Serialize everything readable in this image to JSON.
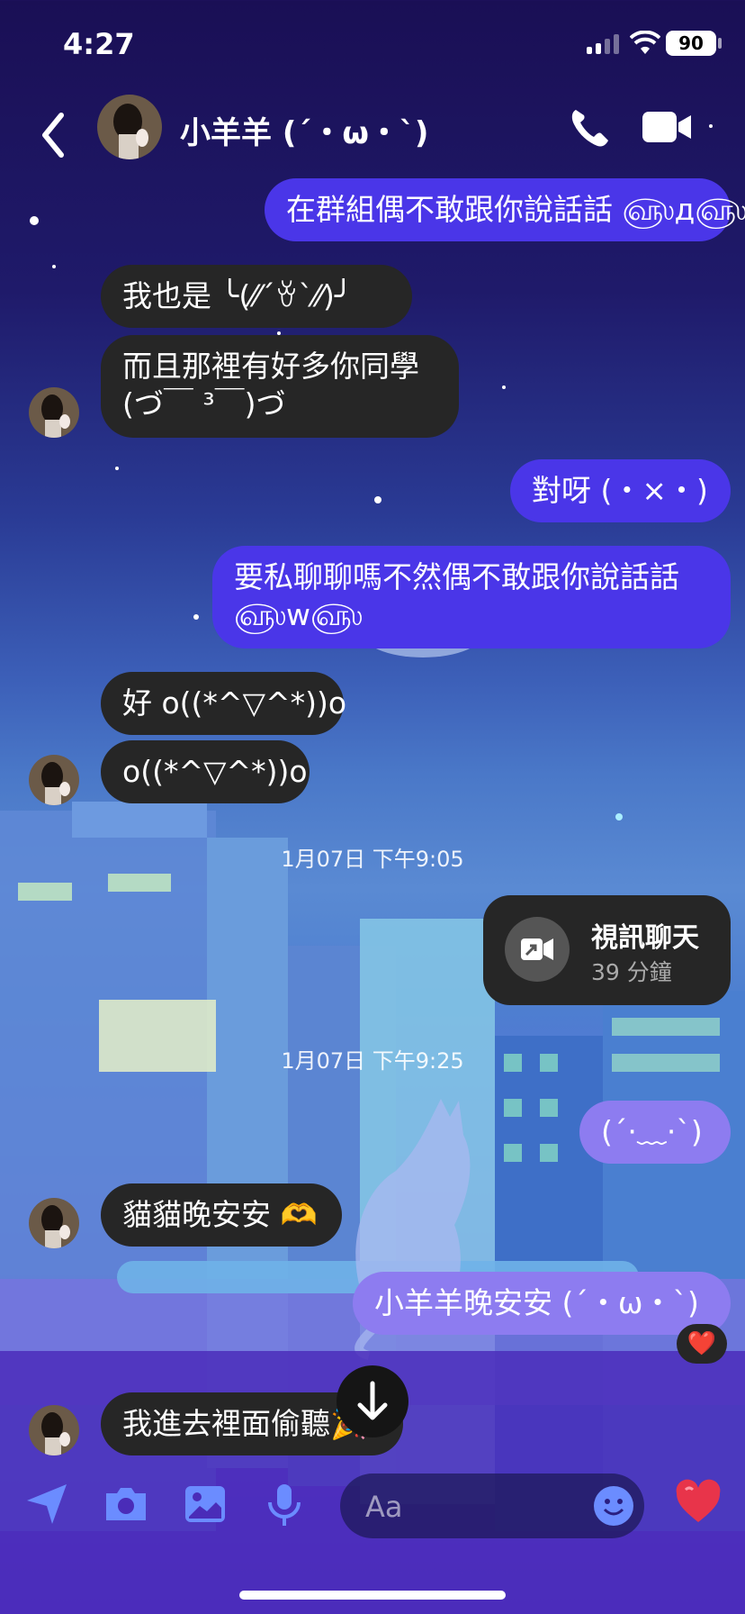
{
  "status": {
    "time": "4:27",
    "battery": "90"
  },
  "header": {
    "contact_name": "小羊羊 (´・ω・`)",
    "icons": {
      "back": "chevron-left-icon",
      "call": "phone-icon",
      "video": "video-camera-icon"
    }
  },
  "messages": [
    {
      "side": "me",
      "text": "在群組偶不敢跟你說話話 ௵д௵"
    },
    {
      "side": "them",
      "text": "我也是 ╰(⁄⁄´ꈊ`⁄⁄)╯"
    },
    {
      "side": "them",
      "text": "而且那裡有好多你同學",
      "text2": "(づ￣ ³￣)づ"
    },
    {
      "side": "me",
      "text": "對呀 (・×・)"
    },
    {
      "side": "me",
      "text": "要私聊聊嗎不然偶不敢跟你說話話",
      "text2": "௵w௵"
    },
    {
      "side": "them",
      "text": "好 o((*^▽^*))o"
    },
    {
      "side": "them",
      "text": "o((*^▽^*))o"
    },
    {
      "side": "me",
      "text": "(´·﹏·`)"
    },
    {
      "side": "them",
      "text": "貓貓晚安安 🫶"
    },
    {
      "side": "me",
      "text": "小羊羊晚安安 (´・ω・`)"
    },
    {
      "side": "them",
      "text": "我進去裡面偷聽🎉"
    }
  ],
  "timestamps": [
    "1月07日 下午9:05",
    "1月07日 下午9:25"
  ],
  "video_call": {
    "title": "視訊聊天",
    "duration": "39 分鐘"
  },
  "reaction": "❤️",
  "composer": {
    "placeholder": "Aa",
    "heart": "❤️",
    "icons": [
      "location-arrow-icon",
      "camera-icon",
      "photo-icon",
      "microphone-icon",
      "emoji-icon",
      "heart-icon"
    ]
  }
}
